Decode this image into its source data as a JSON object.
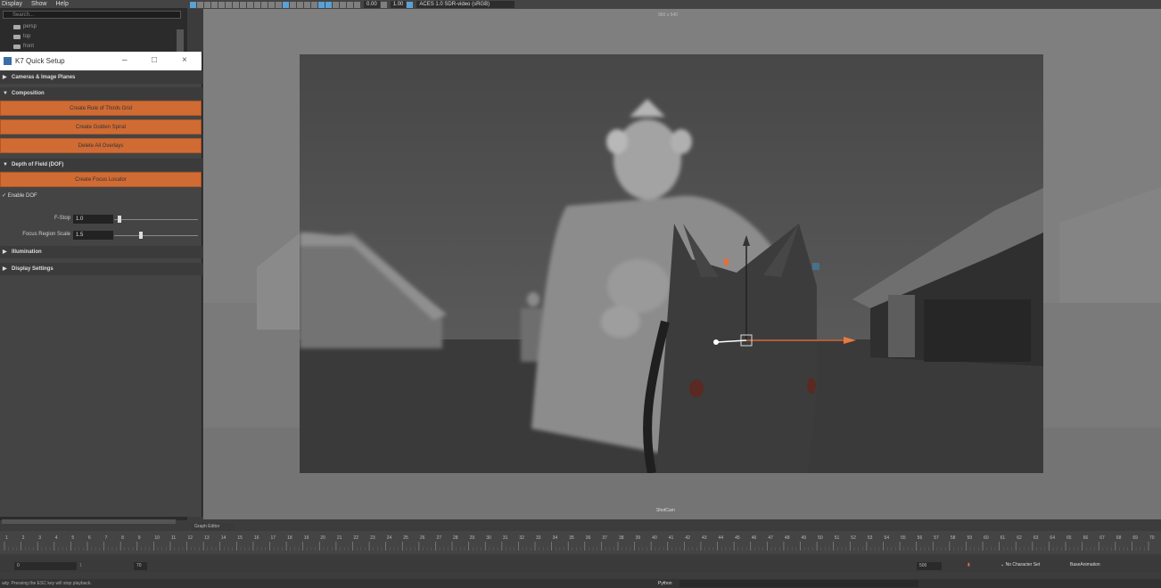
{
  "menubar": {
    "items": [
      "Display",
      "Show",
      "Help"
    ]
  },
  "outliner": {
    "search_placeholder": "Search...",
    "items": [
      "persp",
      "top",
      "front"
    ]
  },
  "viewport_toolbar": {
    "exposure": "0.00",
    "gamma": "1.00",
    "colorspace": "ACES 1.0 SDR-video (sRGB)"
  },
  "viewport": {
    "resolution_label": "960 x 540",
    "camera_label": "ShotCam"
  },
  "quick_setup": {
    "title": "K7 Quick Setup",
    "sections": {
      "cameras": "Cameras & Image Planes",
      "composition": "Composition",
      "dof": "Depth of Field (DOF)",
      "illumination": "Illumination",
      "display": "Display Settings"
    },
    "buttons": {
      "rule_of_thirds": "Create Rule of Thirds Grid",
      "golden_spiral": "Create Golden Spiral",
      "delete_overlays": "Delete All Overlays",
      "focus_locator": "Create Focus Locator"
    },
    "enable_dof": "Enable DOF",
    "fstop": {
      "label": "F-Stop",
      "value": "1.0",
      "level": 0.04
    },
    "focus_region": {
      "label": "Focus Region Scale",
      "value": "1.5",
      "level": 0.3
    }
  },
  "bottom": {
    "graph_editor_tab": "Graph Editor",
    "timeline": {
      "start": 1,
      "end": 70
    },
    "range": {
      "start": "0",
      "current": "1",
      "end": "70",
      "max": "500"
    },
    "character_set": "No Character Set",
    "anim_layer": "BaseAnimation",
    "python_label": "Python",
    "status_message": "ady. Pressing the ESC key will stop playback."
  }
}
